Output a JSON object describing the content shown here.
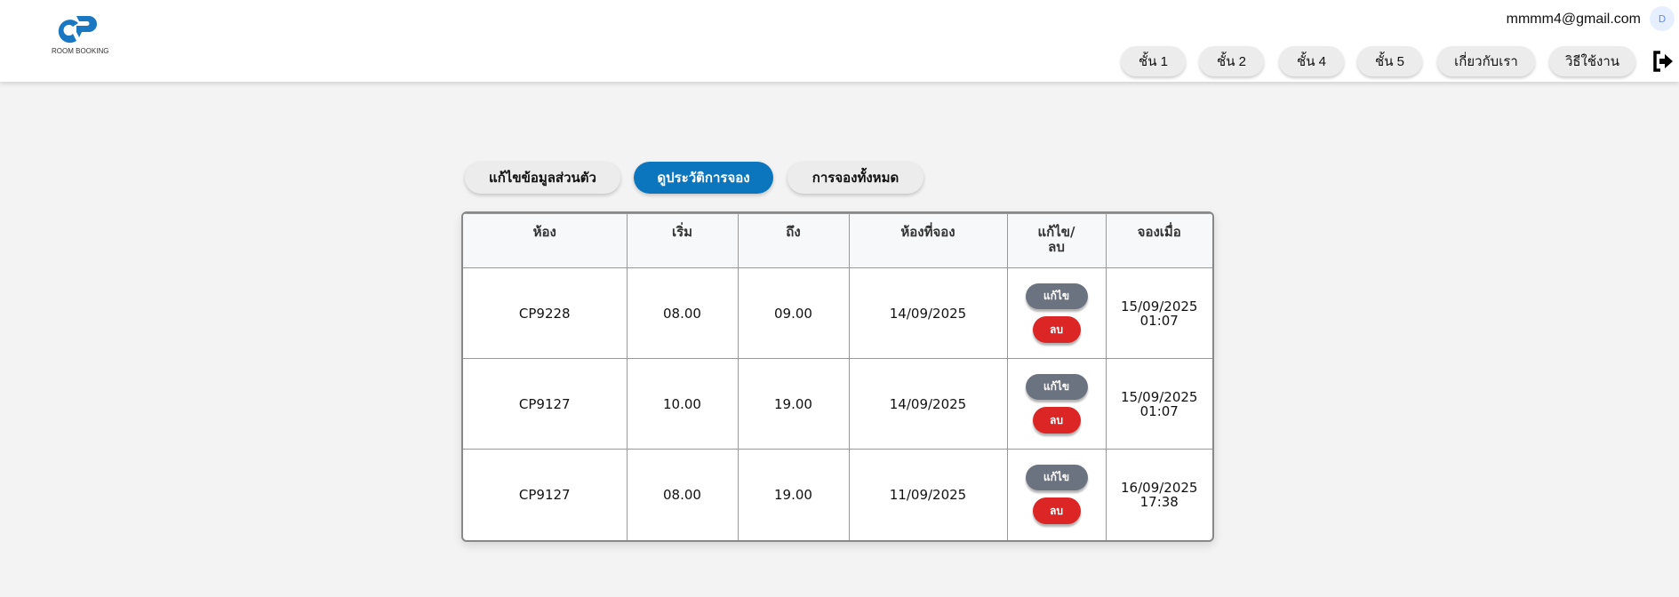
{
  "header": {
    "logo_text": "ROOM BOOKING",
    "email": "mmmm4@gmail.com",
    "avatar_initial": "D",
    "nav": [
      "ชั้น 1",
      "ชั้น 2",
      "ชั้น 4",
      "ชั้น 5",
      "เกี่ยวกับเรา",
      "วิธีใช้งาน"
    ],
    "logout_icon": "sign-out-icon"
  },
  "tabs": [
    {
      "label": "แก้ไขข้อมูลส่วนตัว",
      "active": false
    },
    {
      "label": "ดูประวัติการจอง",
      "active": true
    },
    {
      "label": "การจองทั้งหมด",
      "active": false
    }
  ],
  "colors": {
    "accent": "#0b76bd",
    "edit": "#6b7280",
    "delete": "#dc2626",
    "logo": "#1a78c2"
  },
  "table": {
    "headers": [
      "ห้อง",
      "เริ่ม",
      "ถึง",
      "ห้องที่จอง",
      "แก้ไข/ลบ",
      "จองเมื่อ"
    ],
    "edit_label": "แก้ไข",
    "delete_label": "ลบ",
    "rows": [
      {
        "room": "CP9228",
        "start": "08.00",
        "end": "09.00",
        "date": "14/09/2025",
        "booked_date": "15/09/2025",
        "booked_time": "01:07"
      },
      {
        "room": "CP9127",
        "start": "10.00",
        "end": "19.00",
        "date": "14/09/2025",
        "booked_date": "15/09/2025",
        "booked_time": "01:07"
      },
      {
        "room": "CP9127",
        "start": "08.00",
        "end": "19.00",
        "date": "11/09/2025",
        "booked_date": "16/09/2025",
        "booked_time": "17:38"
      }
    ]
  }
}
